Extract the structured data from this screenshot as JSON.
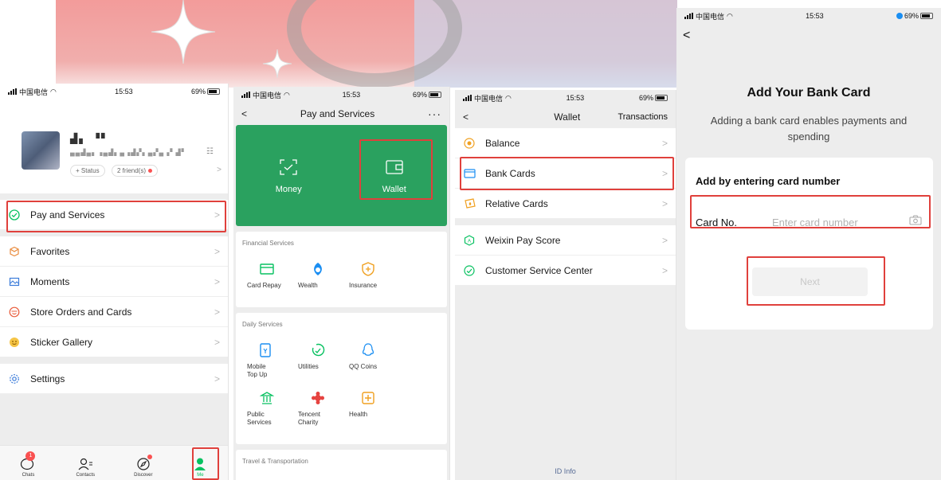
{
  "colors": {
    "accent": "#07c160",
    "wallet_green": "#2aa15f",
    "highlight": "#e0403c",
    "link": "#576b95"
  },
  "status": {
    "carrier": "中国电信",
    "time": "15:53",
    "battery": "69%"
  },
  "me": {
    "status_chip": "+ Status",
    "friends_chip": "2 friend(s)",
    "menu": [
      {
        "label": "Pay and Services",
        "icon": "pay-services-icon"
      },
      {
        "label": "Favorites",
        "icon": "favorites-icon"
      },
      {
        "label": "Moments",
        "icon": "moments-icon"
      },
      {
        "label": "Store Orders and Cards",
        "icon": "store-orders-icon"
      },
      {
        "label": "Sticker Gallery",
        "icon": "sticker-icon"
      },
      {
        "label": "Settings",
        "icon": "settings-icon"
      }
    ],
    "tabs": [
      {
        "label": "Chats",
        "badge": "1"
      },
      {
        "label": "Contacts"
      },
      {
        "label": "Discover"
      },
      {
        "label": "Me"
      }
    ]
  },
  "pay": {
    "title": "Pay and Services",
    "more": "···",
    "hero": [
      {
        "label": "Money",
        "icon": "scan-money-icon"
      },
      {
        "label": "Wallet",
        "icon": "wallet-icon"
      }
    ],
    "financial": {
      "title": "Financial Services",
      "items": [
        "Card Repay",
        "Wealth",
        "Insurance"
      ]
    },
    "daily": {
      "title": "Daily Services",
      "items": [
        "Mobile\nTop Up",
        "Utilities",
        "QQ Coins",
        "Public\nServices",
        "Tencent\nCharity",
        "Health"
      ]
    },
    "travel": {
      "title": "Travel & Transportation"
    }
  },
  "wallet": {
    "title": "Wallet",
    "right": "Transactions",
    "group1": [
      "Balance",
      "Bank Cards",
      "Relative Cards"
    ],
    "group2": [
      "Weixin Pay Score",
      "Customer Service Center"
    ],
    "footer": "ID Info"
  },
  "addcard": {
    "back": "<",
    "title": "Add Your Bank Card",
    "subtitle": "Adding a bank card enables payments and spending",
    "form_title": "Add by entering card number",
    "card_label": "Card No.",
    "card_placeholder": "Enter card number",
    "next": "Next"
  }
}
